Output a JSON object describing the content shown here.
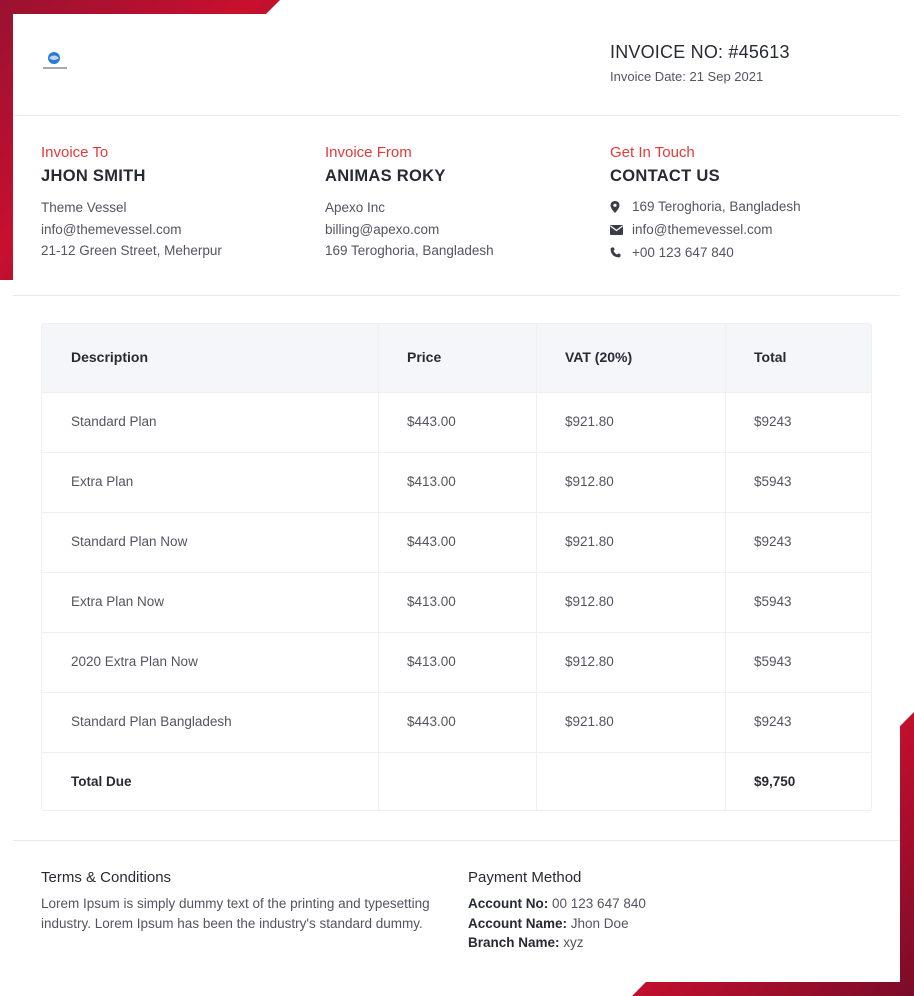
{
  "header": {
    "invoice_no": "INVOICE NO: #45613",
    "invoice_date": "Invoice Date: 21 Sep 2021"
  },
  "invoice_to": {
    "kicker": "Invoice To",
    "name": "JHON SMITH",
    "lines": [
      "Theme Vessel",
      "info@themevessel.com",
      "21-12 Green Street, Meherpur"
    ]
  },
  "invoice_from": {
    "kicker": "Invoice From",
    "name": "ANIMAS ROKY",
    "lines": [
      "Apexo Inc",
      "billing@apexo.com",
      "169 Teroghoria, Bangladesh"
    ]
  },
  "contact": {
    "kicker": "Get In Touch",
    "name": "CONTACT US",
    "address": "169 Teroghoria, Bangladesh",
    "email": "info@themevessel.com",
    "phone": "+00 123 647 840",
    "icons": [
      "map-marker-icon",
      "envelope-icon",
      "phone-icon"
    ]
  },
  "table": {
    "headers": [
      "Description",
      "Price",
      "VAT (20%)",
      "Total"
    ],
    "rows": [
      [
        "Standard Plan",
        "$443.00",
        "$921.80",
        "$9243"
      ],
      [
        "Extra Plan",
        "$413.00",
        "$912.80",
        "$5943"
      ],
      [
        "Standard Plan Now",
        "$443.00",
        "$921.80",
        "$9243"
      ],
      [
        "Extra Plan Now",
        "$413.00",
        "$912.80",
        "$5943"
      ],
      [
        "2020 Extra Plan Now",
        "$413.00",
        "$912.80",
        "$5943"
      ],
      [
        "Standard Plan Bangladesh",
        "$443.00",
        "$921.80",
        "$9243"
      ]
    ],
    "total_label": "Total Due",
    "total_value": "$9,750"
  },
  "terms": {
    "title": "Terms & Conditions",
    "text": "Lorem Ipsum is simply dummy text of the printing and typesetting industry. Lorem Ipsum has been the industry's standard dummy."
  },
  "payment": {
    "title": "Payment Method",
    "account_no_label": "Account No:",
    "account_no": "00 123 647 840",
    "account_name_label": "Account Name:",
    "account_name": "Jhon Doe",
    "branch_name_label": "Branch Name:",
    "branch_name": "xyz"
  },
  "colors": {
    "accent": "#e23a3a",
    "brand_red": "#c8102e",
    "heading": "#262a33",
    "text": "#535461",
    "table_header_bg": "#f5f6fa"
  }
}
